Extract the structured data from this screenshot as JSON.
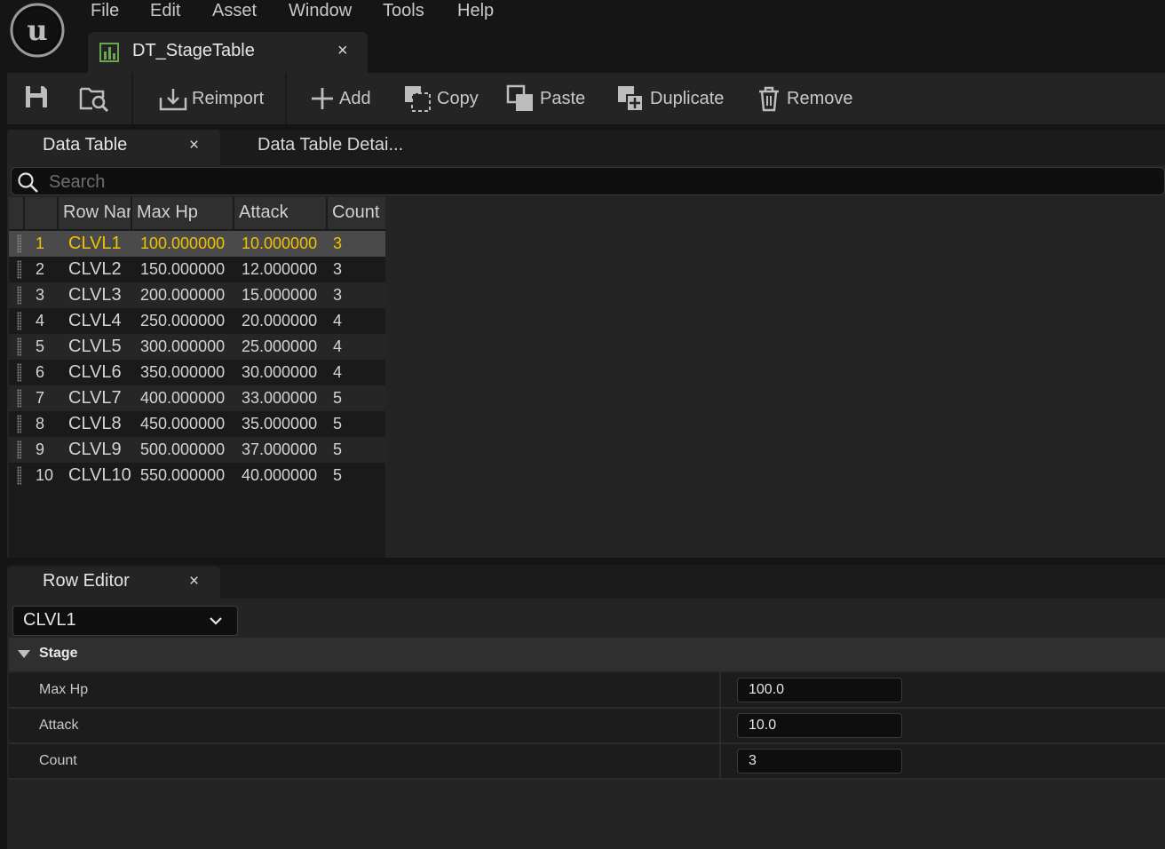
{
  "menu": [
    "File",
    "Edit",
    "Asset",
    "Window",
    "Tools",
    "Help"
  ],
  "document_tab": {
    "title": "DT_StageTable",
    "close": "×"
  },
  "toolbar": {
    "reimport": "Reimport",
    "add": "Add",
    "copy": "Copy",
    "paste": "Paste",
    "duplicate": "Duplicate",
    "remove": "Remove"
  },
  "panels": {
    "data_table_tab": "Data Table",
    "data_table_details_tab": "Data Table Detai...",
    "close": "×",
    "search_placeholder": "Search"
  },
  "table": {
    "headers": [
      "Row Nar",
      "Max Hp",
      "Attack",
      "Count"
    ],
    "rows": [
      {
        "index": "1",
        "name": "CLVL1",
        "max_hp": "100.000000",
        "attack": "10.000000",
        "count": "3"
      },
      {
        "index": "2",
        "name": "CLVL2",
        "max_hp": "150.000000",
        "attack": "12.000000",
        "count": "3"
      },
      {
        "index": "3",
        "name": "CLVL3",
        "max_hp": "200.000000",
        "attack": "15.000000",
        "count": "3"
      },
      {
        "index": "4",
        "name": "CLVL4",
        "max_hp": "250.000000",
        "attack": "20.000000",
        "count": "4"
      },
      {
        "index": "5",
        "name": "CLVL5",
        "max_hp": "300.000000",
        "attack": "25.000000",
        "count": "4"
      },
      {
        "index": "6",
        "name": "CLVL6",
        "max_hp": "350.000000",
        "attack": "30.000000",
        "count": "4"
      },
      {
        "index": "7",
        "name": "CLVL7",
        "max_hp": "400.000000",
        "attack": "33.000000",
        "count": "5"
      },
      {
        "index": "8",
        "name": "CLVL8",
        "max_hp": "450.000000",
        "attack": "35.000000",
        "count": "5"
      },
      {
        "index": "9",
        "name": "CLVL9",
        "max_hp": "500.000000",
        "attack": "37.000000",
        "count": "5"
      },
      {
        "index": "10",
        "name": "CLVL10",
        "max_hp": "550.000000",
        "attack": "40.000000",
        "count": "5"
      }
    ],
    "selected_row_color": "#f0c200"
  },
  "row_editor": {
    "tab": "Row Editor",
    "selected_row": "CLVL1",
    "category": "Stage",
    "properties": [
      {
        "name": "Max Hp",
        "value": "100.0"
      },
      {
        "name": "Attack",
        "value": "10.0"
      },
      {
        "name": "Count",
        "value": "3"
      }
    ]
  }
}
